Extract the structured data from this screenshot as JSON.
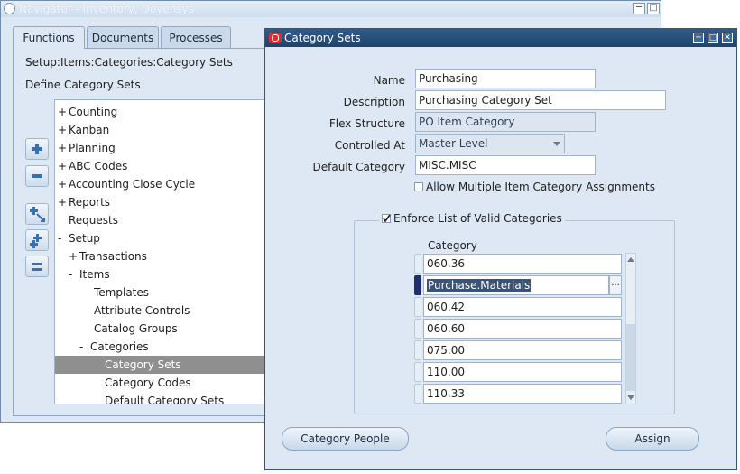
{
  "navigator": {
    "title": "Navigator - Inventory, Doyensys",
    "tabs": [
      "Functions",
      "Documents",
      "Processes"
    ],
    "breadcrumb": "Setup:Items:Categories:Category Sets",
    "define_label": "Define Category Sets",
    "tree": [
      {
        "toggle": "+",
        "label": "Counting",
        "level": 0
      },
      {
        "toggle": "+",
        "label": "Kanban",
        "level": 0
      },
      {
        "toggle": "+",
        "label": "Planning",
        "level": 0
      },
      {
        "toggle": "+",
        "label": "ABC Codes",
        "level": 0
      },
      {
        "toggle": "+",
        "label": "Accounting Close Cycle",
        "level": 0
      },
      {
        "toggle": "+",
        "label": "Reports",
        "level": 0
      },
      {
        "toggle": "",
        "label": "Requests",
        "level": 0
      },
      {
        "toggle": "-",
        "label": "Setup",
        "level": 0
      },
      {
        "toggle": "+",
        "label": "Transactions",
        "level": 1
      },
      {
        "toggle": "-",
        "label": "Items",
        "level": 1
      },
      {
        "toggle": "",
        "label": "Templates",
        "level": 2
      },
      {
        "toggle": "",
        "label": "Attribute Controls",
        "level": 2
      },
      {
        "toggle": "",
        "label": "Catalog Groups",
        "level": 2
      },
      {
        "toggle": "-",
        "label": "Categories",
        "level": 2
      },
      {
        "toggle": "",
        "label": "Category Sets",
        "level": 3,
        "selected": true
      },
      {
        "toggle": "",
        "label": "Category Codes",
        "level": 3
      },
      {
        "toggle": "",
        "label": "Default Category Sets",
        "level": 3
      }
    ]
  },
  "dialog": {
    "title": "Category Sets",
    "name_label": "Name",
    "name_value": "Purchasing",
    "description_label": "Description",
    "description_value": "Purchasing Category Set",
    "flex_label": "Flex Structure",
    "flex_value": "PO Item Category",
    "controlled_label": "Controlled At",
    "controlled_value": "Master Level",
    "default_cat_label": "Default Category",
    "default_cat_value": "MISC.MISC",
    "allow_multiple_label": "Allow Multiple Item Category Assignments",
    "allow_multiple_checked": false,
    "enforce_label": "Enforce List of Valid Categories",
    "enforce_checked": true,
    "category_header": "Category",
    "categories": [
      "060.36",
      "Purchase.Materials",
      "060.42",
      "060.60",
      "075.00",
      "110.00",
      "110.33"
    ],
    "lov_glyph": "...",
    "category_people_button": "Category People",
    "assign_button": "Assign"
  },
  "colors": {
    "window_bg": "#dde8f4",
    "dialog_titlebar": "#2a4f7b",
    "selection": "#3a5478",
    "tree_selected": "#8f8f8f",
    "oracle_red": "#e32b2b"
  }
}
